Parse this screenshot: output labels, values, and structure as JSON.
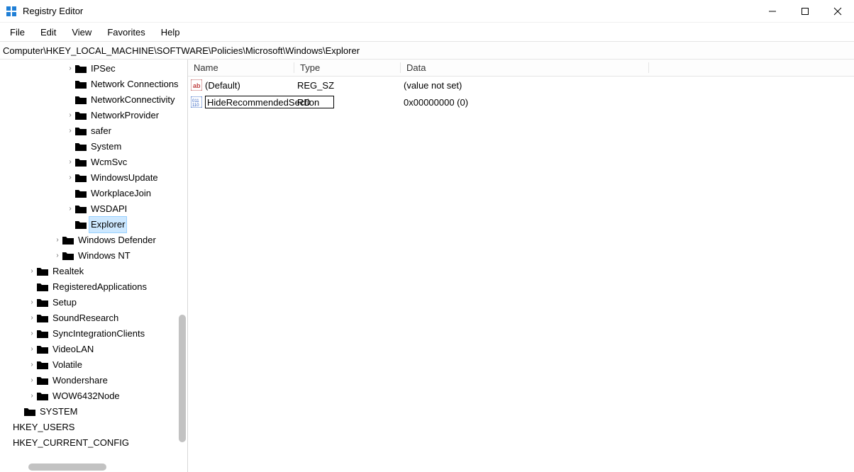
{
  "window": {
    "title": "Registry Editor"
  },
  "menu": {
    "file": "File",
    "edit": "Edit",
    "view": "View",
    "favorites": "Favorites",
    "help": "Help"
  },
  "address": "Computer\\HKEY_LOCAL_MACHINE\\SOFTWARE\\Policies\\Microsoft\\Windows\\Explorer",
  "columns": {
    "name": "Name",
    "type": "Type",
    "data": "Data"
  },
  "tree": {
    "items": [
      {
        "indent": 4,
        "expand": ">",
        "folder": true,
        "label": "IPSec"
      },
      {
        "indent": 4,
        "expand": "",
        "folder": true,
        "label": "Network Connections"
      },
      {
        "indent": 4,
        "expand": "",
        "folder": true,
        "label": "NetworkConnectivity"
      },
      {
        "indent": 4,
        "expand": ">",
        "folder": true,
        "label": "NetworkProvider"
      },
      {
        "indent": 4,
        "expand": ">",
        "folder": true,
        "label": "safer"
      },
      {
        "indent": 4,
        "expand": "",
        "folder": true,
        "label": "System"
      },
      {
        "indent": 4,
        "expand": ">",
        "folder": true,
        "label": "WcmSvc"
      },
      {
        "indent": 4,
        "expand": ">",
        "folder": true,
        "label": "WindowsUpdate"
      },
      {
        "indent": 4,
        "expand": "",
        "folder": true,
        "label": "WorkplaceJoin"
      },
      {
        "indent": 4,
        "expand": ">",
        "folder": true,
        "label": "WSDAPI"
      },
      {
        "indent": 4,
        "expand": "",
        "folder": true,
        "label": "Explorer",
        "selected": true,
        "open": true
      },
      {
        "indent": 3,
        "expand": ">",
        "folder": true,
        "label": "Windows Defender"
      },
      {
        "indent": 3,
        "expand": ">",
        "folder": true,
        "label": "Windows NT"
      },
      {
        "indent": 1,
        "expand": ">",
        "folder": true,
        "label": "Realtek"
      },
      {
        "indent": 1,
        "expand": "",
        "folder": true,
        "label": "RegisteredApplications"
      },
      {
        "indent": 1,
        "expand": ">",
        "folder": true,
        "label": "Setup"
      },
      {
        "indent": 1,
        "expand": ">",
        "folder": true,
        "label": "SoundResearch"
      },
      {
        "indent": 1,
        "expand": ">",
        "folder": true,
        "label": "SyncIntegrationClients"
      },
      {
        "indent": 1,
        "expand": ">",
        "folder": true,
        "label": "VideoLAN"
      },
      {
        "indent": 1,
        "expand": ">",
        "folder": true,
        "label": "Volatile"
      },
      {
        "indent": 1,
        "expand": ">",
        "folder": true,
        "label": "Wondershare"
      },
      {
        "indent": 1,
        "expand": ">",
        "folder": true,
        "label": "WOW6432Node"
      },
      {
        "indent": 0,
        "expand": "",
        "folder": true,
        "label": "SYSTEM"
      },
      {
        "indent": -1,
        "expand": "",
        "folder": false,
        "label": "HKEY_USERS"
      },
      {
        "indent": -1,
        "expand": "",
        "folder": false,
        "label": "HKEY_CURRENT_CONFIG"
      }
    ]
  },
  "values": [
    {
      "icon": "string",
      "name": "(Default)",
      "type": "REG_SZ",
      "data": "(value not set)",
      "editing": false
    },
    {
      "icon": "dword",
      "name": "HideRecommendedSection",
      "type": "RD",
      "data": "0x00000000 (0)",
      "editing": true
    }
  ]
}
